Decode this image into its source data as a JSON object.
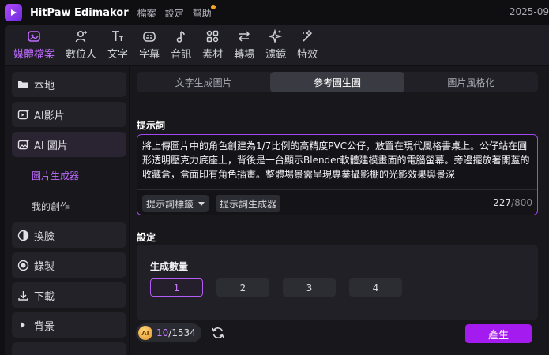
{
  "app": {
    "name": "HitPaw Edimakor",
    "menu": [
      "檔案",
      "設定",
      "幫助"
    ],
    "date": "2025-09"
  },
  "toolbar": {
    "items": [
      {
        "label": "媒體檔案",
        "icon": "media-icon",
        "active": true
      },
      {
        "label": "數位人",
        "icon": "avatar-add-icon"
      },
      {
        "label": "文字",
        "icon": "text-icon"
      },
      {
        "label": "字幕",
        "icon": "subtitle-icon"
      },
      {
        "label": "音訊",
        "icon": "music-note-icon"
      },
      {
        "label": "素材",
        "icon": "elements-icon"
      },
      {
        "label": "轉場",
        "icon": "transition-icon"
      },
      {
        "label": "濾鏡",
        "icon": "sparkle-icon"
      },
      {
        "label": "特效",
        "icon": "effects-icon"
      }
    ]
  },
  "sidebar": {
    "items": [
      {
        "label": "本地",
        "icon": "folder-icon"
      },
      {
        "label": "AI影片",
        "icon": "ai-video-icon"
      },
      {
        "label": "AI 圖片",
        "icon": "ai-image-icon",
        "active": true
      },
      {
        "label": "換臉",
        "icon": "face-swap-icon"
      },
      {
        "label": "錄製",
        "icon": "record-icon"
      },
      {
        "label": "下載",
        "icon": "download-icon"
      },
      {
        "label": "背景",
        "icon": "triangle-right-icon"
      }
    ],
    "subitems": [
      {
        "label": "圖片生成器",
        "active": true
      },
      {
        "label": "我的創作"
      }
    ]
  },
  "main": {
    "tabs": [
      {
        "label": "文字生成圖片"
      },
      {
        "label": "參考圖生圖",
        "active": true
      },
      {
        "label": "圖片風格化"
      }
    ],
    "prompt": {
      "heading": "提示詞",
      "text": "將上傳圖片中的角色創建為1/7比例的高精度PVC公仔，放置在現代風格書桌上。公仔站在圓形透明壓克力底座上，背後是一台顯示Blender軟體建模畫面的電腦螢幕。旁邊擺放著開蓋的收藏盒，盒面印有角色插畫。整體場景需呈現專業攝影棚的光影效果與景深",
      "tag_button": "提示詞標籤",
      "generator_button": "提示詞生成器",
      "count": "227",
      "max": "/800"
    },
    "settings": {
      "heading": "設定",
      "quantity_label": "生成數量",
      "quantity_options": [
        "1",
        "2",
        "3",
        "4"
      ],
      "selected": "1"
    },
    "footer": {
      "coin_label": "AI",
      "credits_used": "10",
      "credits_total": "/1534",
      "generate_label": "產生"
    }
  },
  "colors": {
    "accent": "#a41bef",
    "accent_text": "#c06cff",
    "background": "#101014",
    "panel": "#17171c"
  }
}
